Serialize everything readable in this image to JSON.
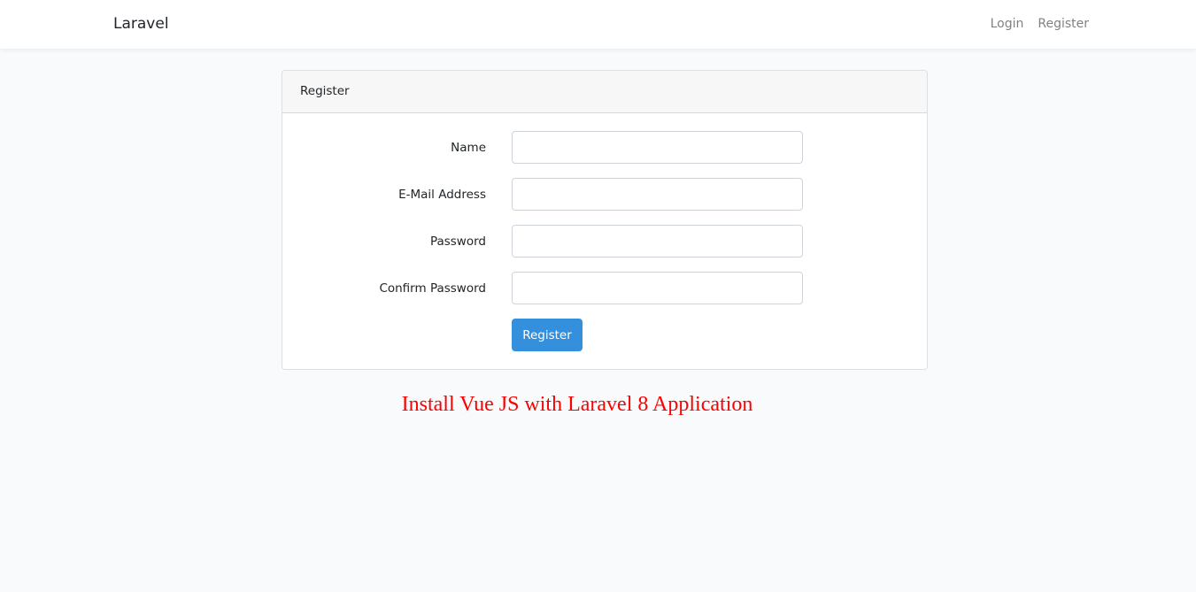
{
  "navbar": {
    "brand": "Laravel",
    "links": [
      {
        "label": "Login"
      },
      {
        "label": "Register"
      }
    ]
  },
  "card": {
    "header": "Register",
    "fields": [
      {
        "label": "Name",
        "value": "",
        "placeholder": ""
      },
      {
        "label": "E-Mail Address",
        "value": "",
        "placeholder": ""
      },
      {
        "label": "Password",
        "value": "",
        "placeholder": ""
      },
      {
        "label": "Confirm Password",
        "value": "",
        "placeholder": ""
      }
    ],
    "submit_label": "Register"
  },
  "caption": "Install Vue JS with Laravel 8 Application",
  "colors": {
    "primary": "#3490dc",
    "caption": "#ff0000",
    "background": "#f8fafc"
  }
}
